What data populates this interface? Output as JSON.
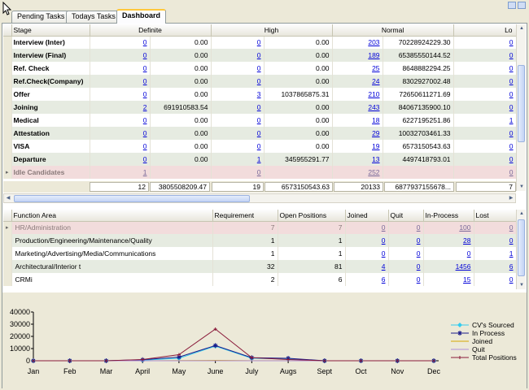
{
  "tabs": [
    "Pending Tasks",
    "Todays Tasks",
    "Dashboard"
  ],
  "active_tab": "Dashboard",
  "stage_grid": {
    "headers": [
      "Stage",
      "Definite",
      "High",
      "Normal",
      "Lo"
    ],
    "rows": [
      {
        "stage": "Interview (Inter)",
        "c1": "0",
        "v1": "0.00",
        "c2": "0",
        "v2": "0.00",
        "c3": "203",
        "v3": "70228924229.30",
        "c4": "0"
      },
      {
        "stage": "Interview (Final)",
        "c1": "0",
        "v1": "0.00",
        "c2": "0",
        "v2": "0.00",
        "c3": "189",
        "v3": "65385550144.52",
        "c4": "0"
      },
      {
        "stage": "Ref. Check",
        "c1": "0",
        "v1": "0.00",
        "c2": "0",
        "v2": "0.00",
        "c3": "25",
        "v3": "8648882294.25",
        "c4": "0"
      },
      {
        "stage": "Ref.Check(Company)",
        "c1": "0",
        "v1": "0.00",
        "c2": "0",
        "v2": "0.00",
        "c3": "24",
        "v3": "8302927002.48",
        "c4": "0"
      },
      {
        "stage": "Offer",
        "c1": "0",
        "v1": "0.00",
        "c2": "3",
        "v2": "1037865875.31",
        "c3": "210",
        "v3": "72650611271.69",
        "c4": "0"
      },
      {
        "stage": "Joining",
        "c1": "2",
        "v1": "691910583.54",
        "c2": "0",
        "v2": "0.00",
        "c3": "243",
        "v3": "84067135900.10",
        "c4": "0"
      },
      {
        "stage": "Medical",
        "c1": "0",
        "v1": "0.00",
        "c2": "0",
        "v2": "0.00",
        "c3": "18",
        "v3": "6227195251.86",
        "c4": "1"
      },
      {
        "stage": "Attestation",
        "c1": "0",
        "v1": "0.00",
        "c2": "0",
        "v2": "0.00",
        "c3": "29",
        "v3": "10032703461.33",
        "c4": "0"
      },
      {
        "stage": "VISA",
        "c1": "0",
        "v1": "0.00",
        "c2": "0",
        "v2": "0.00",
        "c3": "19",
        "v3": "6573150543.63",
        "c4": "0"
      },
      {
        "stage": "Departure",
        "c1": "0",
        "v1": "0.00",
        "c2": "1",
        "v2": "345955291.77",
        "c3": "13",
        "v3": "4497418793.01",
        "c4": "0"
      },
      {
        "stage": "Idle Candidates",
        "c1": "1",
        "v1": "",
        "c2": "0",
        "v2": "",
        "c3": "252",
        "v3": "",
        "c4": "0"
      }
    ],
    "totals": [
      "12",
      "3805508209.47",
      "19",
      "6573150543.63",
      "20133",
      "6877937155678...",
      "7"
    ]
  },
  "function_grid": {
    "headers": [
      "Function Area",
      "Requirement",
      "Open Positions",
      "Joined",
      "Quit",
      "In-Process",
      "Lost"
    ],
    "rows": [
      {
        "area": "HR/Administration",
        "req": "7",
        "open": "7",
        "joined": "0",
        "quit": "0",
        "inproc": "100",
        "lost": "0"
      },
      {
        "area": "Production/Engineering/Maintenance/Quality",
        "req": "1",
        "open": "1",
        "joined": "0",
        "quit": "0",
        "inproc": "28",
        "lost": "0"
      },
      {
        "area": "Marketing/Advertising/Media/Communications",
        "req": "1",
        "open": "1",
        "joined": "0",
        "quit": "0",
        "inproc": "0",
        "lost": "1"
      },
      {
        "area": "Architectural/Interior t",
        "req": "32",
        "open": "81",
        "joined": "4",
        "quit": "0",
        "inproc": "1456",
        "lost": "6"
      },
      {
        "area": "CRMi",
        "req": "2",
        "open": "6",
        "joined": "6",
        "quit": "0",
        "inproc": "15",
        "lost": "0"
      }
    ]
  },
  "chart_data": {
    "type": "line",
    "categories": [
      "Jan",
      "Feb",
      "Mar",
      "April",
      "May",
      "June",
      "July",
      "Augs",
      "Sept",
      "Oct",
      "Nov",
      "Dec"
    ],
    "yticks": [
      "40000",
      "30000",
      "20000",
      "10000",
      "0"
    ],
    "ylim": [
      0,
      40000
    ],
    "series": [
      {
        "name": "CV's Sourced",
        "color": "#33ccee",
        "marker": "diamond",
        "values": [
          0,
          0,
          0,
          500,
          2000,
          12000,
          2000,
          1500,
          0,
          0,
          0,
          0
        ]
      },
      {
        "name": "In Process",
        "color": "#1a1a8a",
        "marker": "star",
        "values": [
          0,
          0,
          0,
          800,
          3000,
          12500,
          2500,
          2000,
          0,
          0,
          0,
          0
        ]
      },
      {
        "name": "Joined",
        "color": "#d6a800",
        "marker": "none",
        "values": [
          0,
          0,
          0,
          0,
          200,
          300,
          100,
          50,
          0,
          0,
          0,
          0
        ]
      },
      {
        "name": "Quit",
        "color": "#b08fd8",
        "marker": "none",
        "values": [
          0,
          0,
          0,
          0,
          0,
          0,
          0,
          0,
          0,
          0,
          0,
          0
        ]
      },
      {
        "name": "Total Positions",
        "color": "#8a1a3a",
        "marker": "plus",
        "values": [
          0,
          0,
          0,
          1000,
          5000,
          26000,
          2500,
          1000,
          0,
          0,
          0,
          0
        ]
      }
    ]
  }
}
